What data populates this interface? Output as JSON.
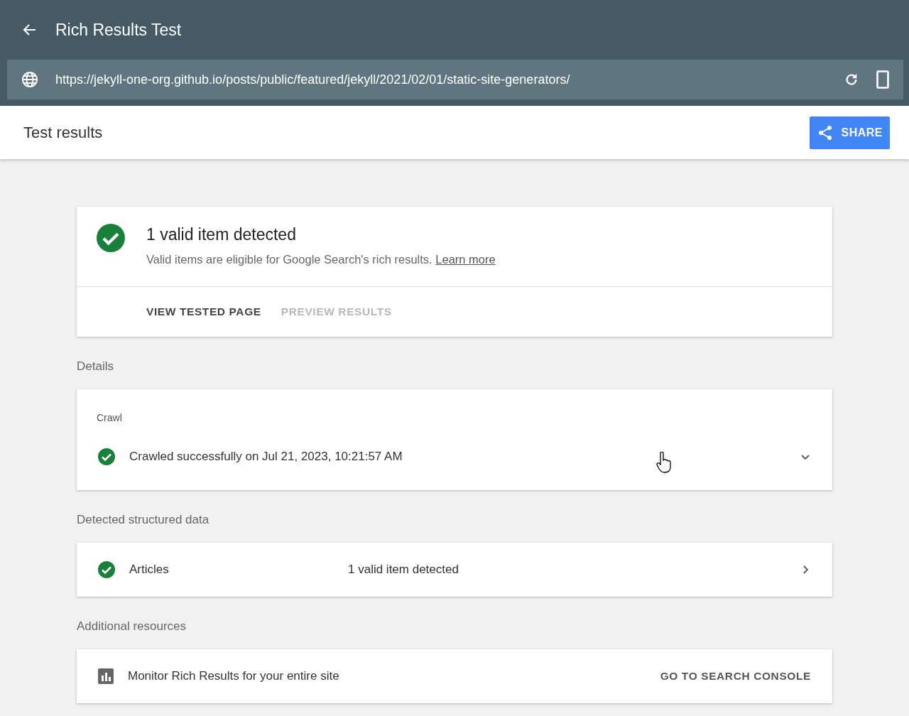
{
  "app_bar": {
    "title": "Rich Results Test"
  },
  "url_bar": {
    "url": "https://jekyll-one-org.github.io/posts/public/featured/jekyll/2021/02/01/static-site-generators/"
  },
  "header": {
    "title": "Test results",
    "share_label": "SHARE"
  },
  "summary": {
    "title": "1 valid item detected",
    "description": "Valid items are eligible for Google Search's rich results.",
    "link": "Learn more",
    "actions": [
      {
        "label": "VIEW TESTED PAGE",
        "disabled": false
      },
      {
        "label": "PREVIEW RESULTS",
        "disabled": true
      }
    ]
  },
  "sections": [
    {
      "kind": "crawl",
      "heading": "Details",
      "label": "Crawl",
      "status": "Crawled successfully on Jul 21, 2023, 10:21:57 AM",
      "expanded": false
    },
    {
      "kind": "structured",
      "heading": "Detected structured data",
      "name": "Articles",
      "status": "1 valid item detected"
    },
    {
      "kind": "resource",
      "heading": "Additional resources",
      "text": "Monitor Rich Results for your entire site",
      "action": "GO TO SEARCH CONSOLE"
    }
  ]
}
